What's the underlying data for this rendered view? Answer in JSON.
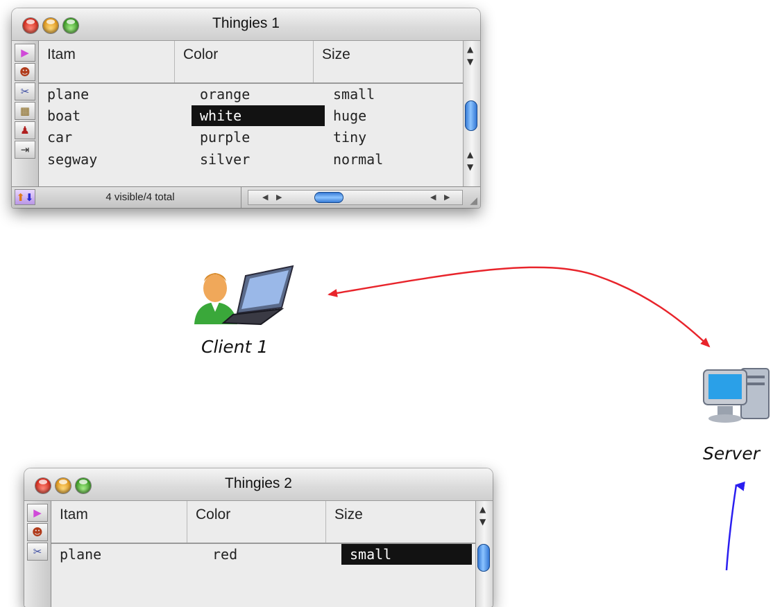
{
  "columns": [
    "Itam",
    "Color",
    "Size"
  ],
  "window1": {
    "title": "Thingies 1",
    "status": "4 visible/4 total",
    "rows": [
      {
        "item": "plane",
        "color": "orange",
        "size": "small"
      },
      {
        "item": "boat",
        "color": "white",
        "size": "huge"
      },
      {
        "item": "car",
        "color": "purple",
        "size": "tiny"
      },
      {
        "item": "segway",
        "color": "silver",
        "size": "normal"
      }
    ],
    "selected_cell": "boat / Color"
  },
  "window2": {
    "title": "Thingies 2",
    "rows": [
      {
        "item": "plane",
        "color": "red",
        "size": "small"
      }
    ],
    "selected_cell": "plane / Size"
  },
  "diagram": {
    "client_label": "Client 1",
    "server_label": "Server",
    "colors": {
      "red_arrow": "#e8242b",
      "blue_arrow": "#2a1ef0"
    },
    "icons": [
      "client-person-icon",
      "laptop-icon",
      "server-computer-icon"
    ]
  }
}
